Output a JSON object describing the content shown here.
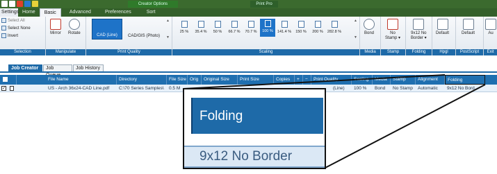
{
  "titlebar": {
    "context_title": "Creator Options",
    "app_title": "Print Pro",
    "qat_colors": [
      "#ffffff",
      "#ffffff",
      "#e0402a",
      "#2a7ad0",
      "#e6d23a"
    ]
  },
  "ribbon_tabs": [
    "Settings",
    "Home",
    "Basic",
    "Advanced",
    "Preferences",
    "Sort"
  ],
  "ribbon": {
    "selection": {
      "label": "Selection",
      "items": [
        "Select All",
        "Select None",
        "Invert"
      ]
    },
    "manipulate": {
      "label": "Manipulate",
      "items": [
        "Mirror",
        "Rotate"
      ]
    },
    "print_quality": {
      "label": "Print Quality",
      "items": [
        "CAD (Line)",
        "CAD/GIS (Photo)"
      ]
    },
    "scaling": {
      "label": "Scaling",
      "items": [
        "25 %",
        "35.4 %",
        "50 %",
        "66.7 %",
        "70.7 %",
        "100 %",
        "141.4 %",
        "150 %",
        "200 %",
        "282.8 %"
      ],
      "selected": "100 %"
    },
    "media": {
      "label": "Media",
      "button": "Bond"
    },
    "stamp": {
      "label": "Stamp",
      "button_line1": "No",
      "button_line2": "Stamp ▾"
    },
    "folding": {
      "label": "Folding",
      "button_line1": "9x12 No",
      "button_line2": "Border ▾"
    },
    "hpgl": {
      "label": "Hpgl",
      "button": "Default"
    },
    "postscript": {
      "label": "PostScript",
      "button": "Default"
    },
    "exit": {
      "label": "Exit",
      "button": "Au"
    }
  },
  "job_tabs": [
    "Job Creator",
    "Job Queue",
    "Job History"
  ],
  "grid": {
    "headers": [
      "File Name",
      "Directory",
      "File Size",
      "Orig",
      "Original Size",
      "Print Size",
      "Copies",
      "Print Quality",
      "Scaling",
      "Media",
      "Stamp",
      "Alignment",
      "Folding"
    ],
    "row": {
      "checked": "✓",
      "file_name": "US - Arch 36x24-CAD Line.pdf",
      "directory": "C:\\70 Series Samples\\",
      "file_size": "0.5 M",
      "print_quality": "(Line)",
      "scaling": "100 %",
      "media": "Bond",
      "stamp": "No Stamp",
      "alignment": "Automatic",
      "folding": "9x12 No Bord"
    }
  },
  "zoom": {
    "header": "Folding",
    "value": "9x12 No Border"
  }
}
